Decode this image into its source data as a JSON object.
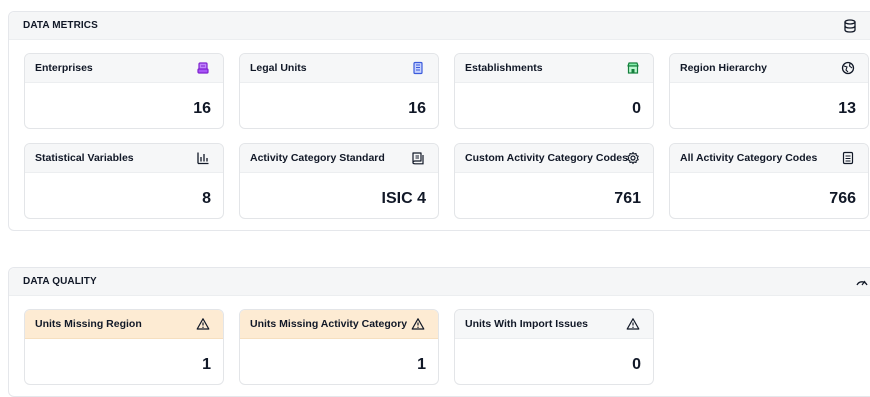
{
  "metrics": {
    "title": "DATA METRICS",
    "icon": "database-icon",
    "cards": [
      {
        "label": "Enterprises",
        "value": "16",
        "icon": "enterprise-icon",
        "color": "#8b3fb8"
      },
      {
        "label": "Legal Units",
        "value": "16",
        "icon": "building-icon",
        "color": "#3b5bdb"
      },
      {
        "label": "Establishments",
        "value": "0",
        "icon": "store-icon",
        "color": "#15803d"
      },
      {
        "label": "Region Hierarchy",
        "value": "13",
        "icon": "globe-icon",
        "color": "#111827"
      },
      {
        "label": "Statistical Variables",
        "value": "8",
        "icon": "bar-chart-icon",
        "color": "#111827"
      },
      {
        "label": "Activity Category Standard",
        "value": "ISIC 4",
        "icon": "book-icon",
        "color": "#111827"
      },
      {
        "label": "Custom Activity Category Codes",
        "value": "761",
        "icon": "gear-icon",
        "color": "#111827"
      },
      {
        "label": "All Activity Category Codes",
        "value": "766",
        "icon": "list-icon",
        "color": "#111827"
      }
    ]
  },
  "quality": {
    "title": "DATA QUALITY",
    "icon": "gauge-icon",
    "warn_color": "#fdebd3",
    "cards": [
      {
        "label": "Units Missing Region",
        "value": "1",
        "icon": "warning-icon",
        "warn": true
      },
      {
        "label": "Units Missing Activity Category",
        "value": "1",
        "icon": "warning-icon",
        "warn": true
      },
      {
        "label": "Units With Import Issues",
        "value": "0",
        "icon": "warning-icon",
        "warn": false
      }
    ]
  }
}
